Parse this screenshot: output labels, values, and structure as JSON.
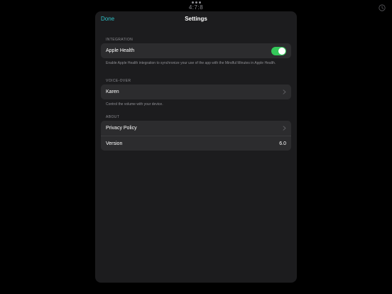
{
  "status_bar": {
    "time": "4:7:8"
  },
  "nav": {
    "done_label": "Done",
    "title": "Settings"
  },
  "integration": {
    "header": "INTEGRATION",
    "apple_health_label": "Apple Health",
    "apple_health_enabled": true,
    "footer": "Enable Apple Health integration to synchronize your use of the app with the Mindful Minutes in Apple Health."
  },
  "voice_over": {
    "header": "VOICE-OVER",
    "voice_label": "Karen",
    "footer": "Control the volume with your device."
  },
  "about": {
    "header": "ABOUT",
    "privacy_label": "Privacy Policy",
    "version_label": "Version",
    "version_value": "6.0"
  },
  "colors": {
    "accent": "#2fc2c8",
    "toggle_on": "#34c759",
    "background": "#000000",
    "sheet": "#1c1c1e",
    "cell": "#2c2c2e"
  },
  "icons": {
    "corner": "clock-icon",
    "disclosure": "chevron-right-icon"
  }
}
